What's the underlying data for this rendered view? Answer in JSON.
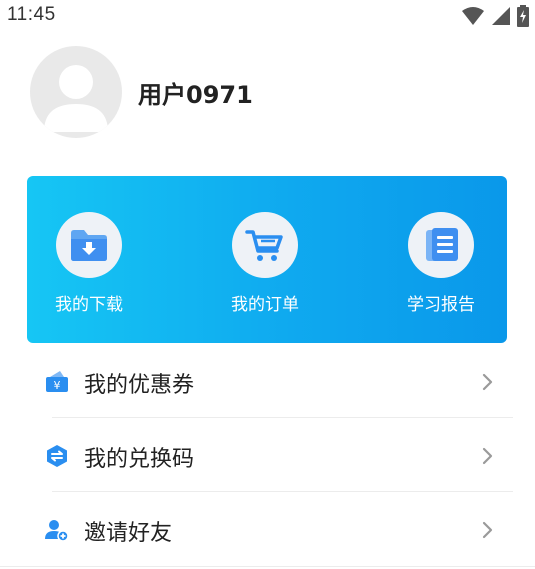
{
  "status_bar": {
    "time": "11:45"
  },
  "profile": {
    "username": "用户0971"
  },
  "quick_actions": [
    {
      "label": "我的下载",
      "icon": "download-folder-icon"
    },
    {
      "label": "我的订单",
      "icon": "cart-icon"
    },
    {
      "label": "学习报告",
      "icon": "report-book-icon"
    }
  ],
  "menu": [
    {
      "label": "我的优惠券",
      "icon": "coupon-icon"
    },
    {
      "label": "我的兑换码",
      "icon": "exchange-code-icon"
    },
    {
      "label": "邀请好友",
      "icon": "invite-friend-icon"
    }
  ],
  "colors": {
    "card_gradient_start": "#16c6f4",
    "card_gradient_end": "#0a98ea",
    "icon_blue": "#2a8ef0",
    "chevron": "#9a9a9a"
  }
}
